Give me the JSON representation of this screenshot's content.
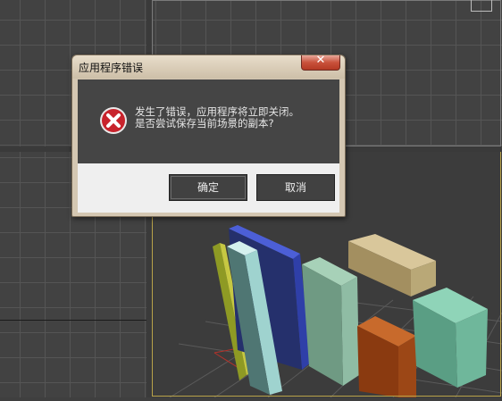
{
  "dialog": {
    "title": "应用程序错误",
    "message": "发生了错误，应用程序将立即关闭。\n是否尝试保存当前场景的副本?",
    "ok_label": "确定",
    "cancel_label": "取消",
    "close_glyph": "✕",
    "icon": "error-icon"
  },
  "colors": {
    "viewport_bg": "#424242",
    "grid_line": "#555555",
    "dialog_frame": "#d4c7b2",
    "content_bg": "#454545",
    "button_bg": "#414141",
    "close_button": "#c9513b",
    "error_red": "#c8232c"
  }
}
